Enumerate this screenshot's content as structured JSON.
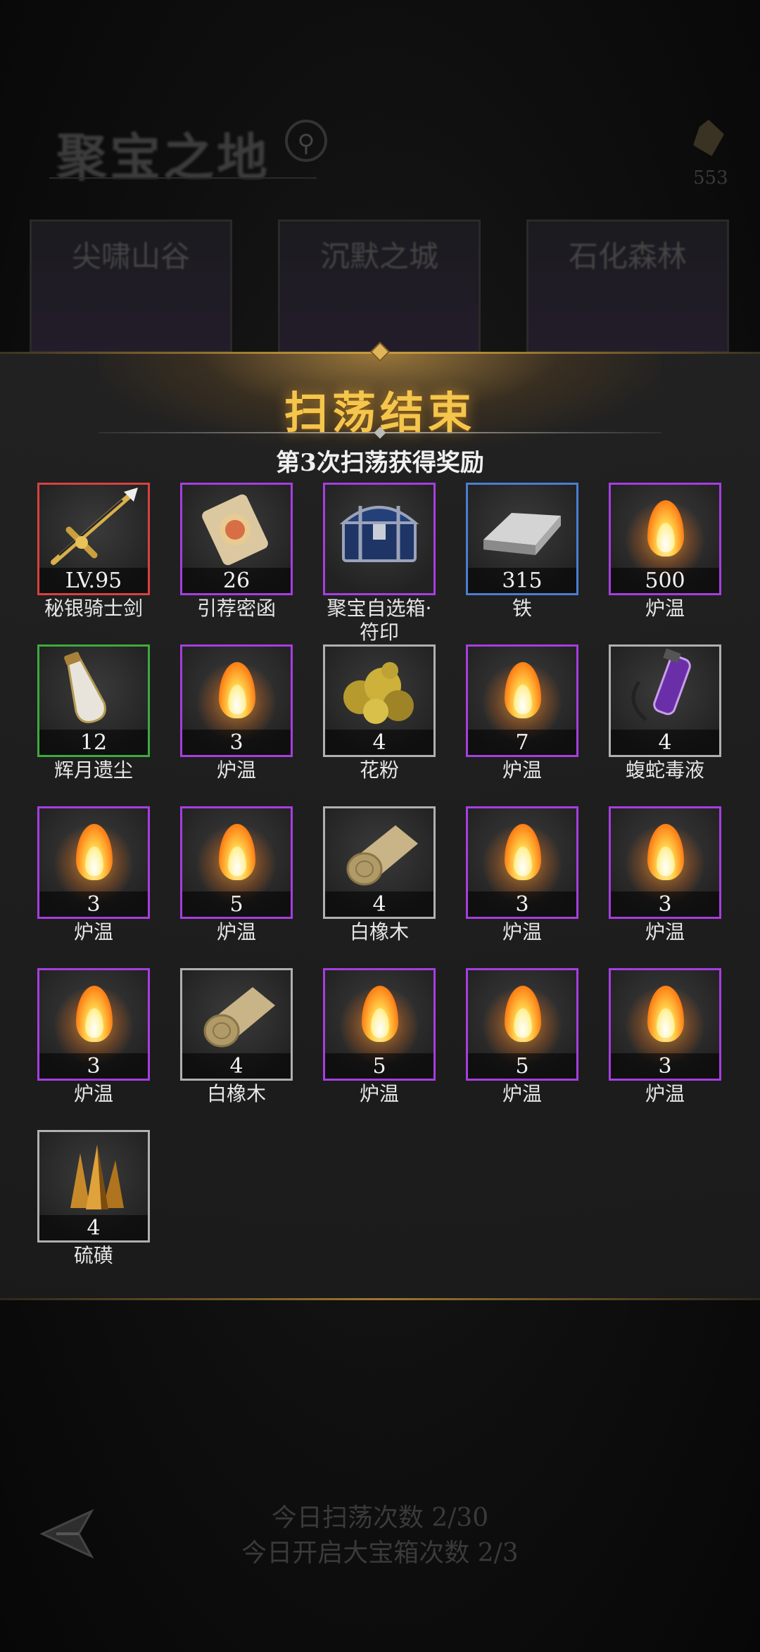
{
  "background": {
    "title": "聚宝之地",
    "currency_value": "553",
    "cards": [
      "尖啸山谷",
      "沉默之城",
      "石化森林"
    ],
    "footer_line1": "今日扫荡次数 2/30",
    "footer_line2": "今日开启大宝箱次数 2/3"
  },
  "modal": {
    "title": "扫荡结束",
    "subtitle": "第3次扫荡获得奖励"
  },
  "colors": {
    "purple": "#a63ee0",
    "red": "#d9413f",
    "blue": "#4a7fd0",
    "green": "#3dab3d",
    "white": "#b0b0b0",
    "title_gold": "#f5c64c"
  },
  "rewards": [
    {
      "name": "秘银骑士剑",
      "qty": "LV.95",
      "rarity": "red",
      "icon": "sword-icon"
    },
    {
      "name": "引荐密函",
      "qty": "26",
      "rarity": "purple",
      "icon": "scroll-icon"
    },
    {
      "name": "聚宝自选箱·符印",
      "qty": "",
      "rarity": "purple",
      "icon": "treasure-chest-icon"
    },
    {
      "name": "铁",
      "qty": "315",
      "rarity": "blue",
      "icon": "iron-ingot-icon"
    },
    {
      "name": "炉温",
      "qty": "500",
      "rarity": "purple",
      "icon": "flame-icon"
    },
    {
      "name": "辉月遗尘",
      "qty": "12",
      "rarity": "green",
      "icon": "dust-vial-icon"
    },
    {
      "name": "炉温",
      "qty": "3",
      "rarity": "purple",
      "icon": "flame-icon"
    },
    {
      "name": "花粉",
      "qty": "4",
      "rarity": "white",
      "icon": "pollen-icon"
    },
    {
      "name": "炉温",
      "qty": "7",
      "rarity": "purple",
      "icon": "flame-icon"
    },
    {
      "name": "蝮蛇毒液",
      "qty": "4",
      "rarity": "white",
      "icon": "poison-vial-icon"
    },
    {
      "name": "炉温",
      "qty": "3",
      "rarity": "purple",
      "icon": "flame-icon"
    },
    {
      "name": "炉温",
      "qty": "5",
      "rarity": "purple",
      "icon": "flame-icon"
    },
    {
      "name": "白橡木",
      "qty": "4",
      "rarity": "white",
      "icon": "wood-log-icon"
    },
    {
      "name": "炉温",
      "qty": "3",
      "rarity": "purple",
      "icon": "flame-icon"
    },
    {
      "name": "炉温",
      "qty": "3",
      "rarity": "purple",
      "icon": "flame-icon"
    },
    {
      "name": "炉温",
      "qty": "3",
      "rarity": "purple",
      "icon": "flame-icon"
    },
    {
      "name": "白橡木",
      "qty": "4",
      "rarity": "white",
      "icon": "wood-log-icon"
    },
    {
      "name": "炉温",
      "qty": "5",
      "rarity": "purple",
      "icon": "flame-icon"
    },
    {
      "name": "炉温",
      "qty": "5",
      "rarity": "purple",
      "icon": "flame-icon"
    },
    {
      "name": "炉温",
      "qty": "3",
      "rarity": "purple",
      "icon": "flame-icon"
    },
    {
      "name": "硫磺",
      "qty": "4",
      "rarity": "white",
      "icon": "sulfur-crystal-icon"
    }
  ]
}
